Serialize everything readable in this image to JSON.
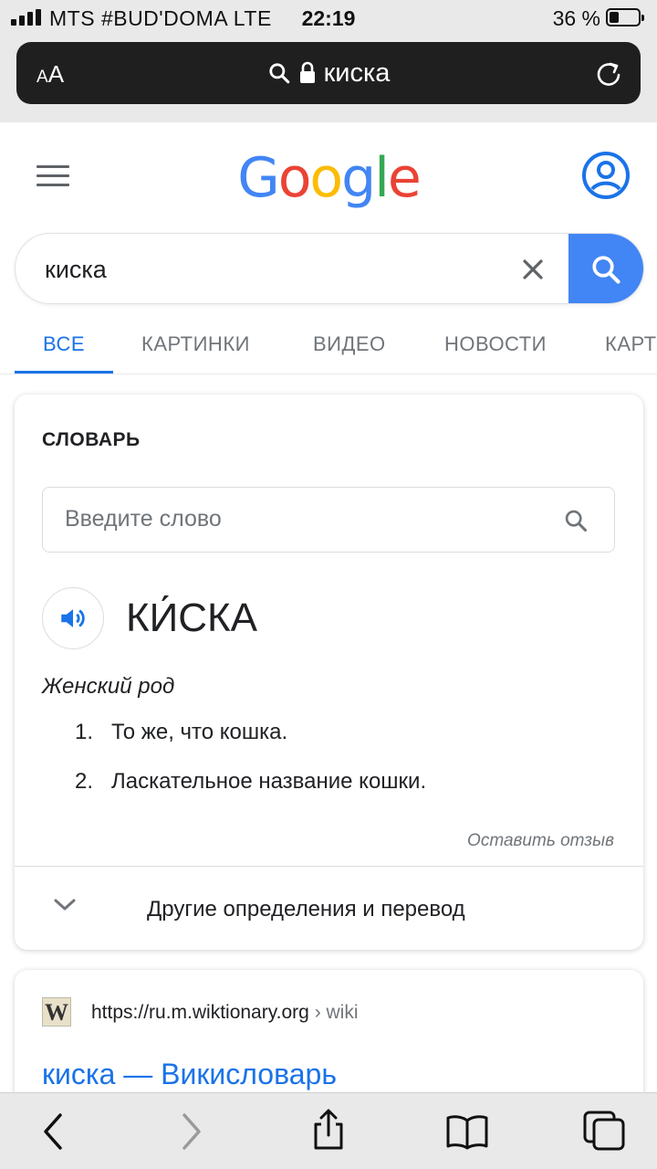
{
  "status_bar": {
    "carrier": "MTS #BUD'DOMA  LTE",
    "time": "22:19",
    "battery": "36 %"
  },
  "browser": {
    "text_size_label": "AA",
    "url_text": "киска",
    "icons": [
      "search-icon",
      "lock-icon",
      "reload-icon"
    ]
  },
  "header": {
    "logo": "Google"
  },
  "search": {
    "query": "киска"
  },
  "tabs": [
    {
      "label": "ВСЕ",
      "active": true
    },
    {
      "label": "КАРТИНКИ",
      "active": false
    },
    {
      "label": "ВИДЕО",
      "active": false
    },
    {
      "label": "НОВОСТИ",
      "active": false
    },
    {
      "label": "КАРТ",
      "active": false
    }
  ],
  "dictionary": {
    "section_title": "СЛОВАРЬ",
    "input_placeholder": "Введите слово",
    "word": "КИ́СКА",
    "part_of_speech": "Женский род",
    "definitions": [
      {
        "num": "1.",
        "text": "То же, что кошка."
      },
      {
        "num": "2.",
        "text": "Ласкательное название кошки."
      }
    ],
    "feedback": "Оставить отзыв",
    "more_label": "Другие определения и перевод"
  },
  "result": {
    "favicon_letter": "W",
    "url": "https://ru.m.wiktionary.org",
    "breadcrumb": " › wiki",
    "title": "киска — Викисловарь"
  },
  "colors": {
    "accent": "#1a73e8",
    "search_button": "#4285f4",
    "google_blue": "#4285f4",
    "google_red": "#ea4335",
    "google_yellow": "#fbbc05",
    "google_green": "#34a853"
  }
}
